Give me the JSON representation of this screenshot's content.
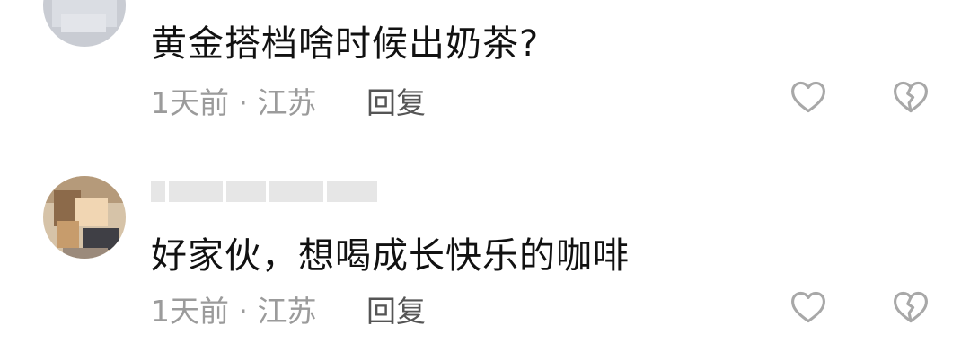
{
  "comments": [
    {
      "text": "黄金搭档啥时候出奶茶?",
      "time_location": "1天前 · 江苏",
      "reply_label": "回复"
    },
    {
      "text": "好家伙，想喝成长快乐的咖啡",
      "time_location": "1天前 · 江苏",
      "reply_label": "回复"
    }
  ],
  "icons": {
    "like": "heart-outline-icon",
    "dislike": "broken-heart-icon"
  },
  "colors": {
    "text": "#111111",
    "meta": "#9b9b9b",
    "reply": "#555555",
    "icon": "#a8a8a8"
  }
}
